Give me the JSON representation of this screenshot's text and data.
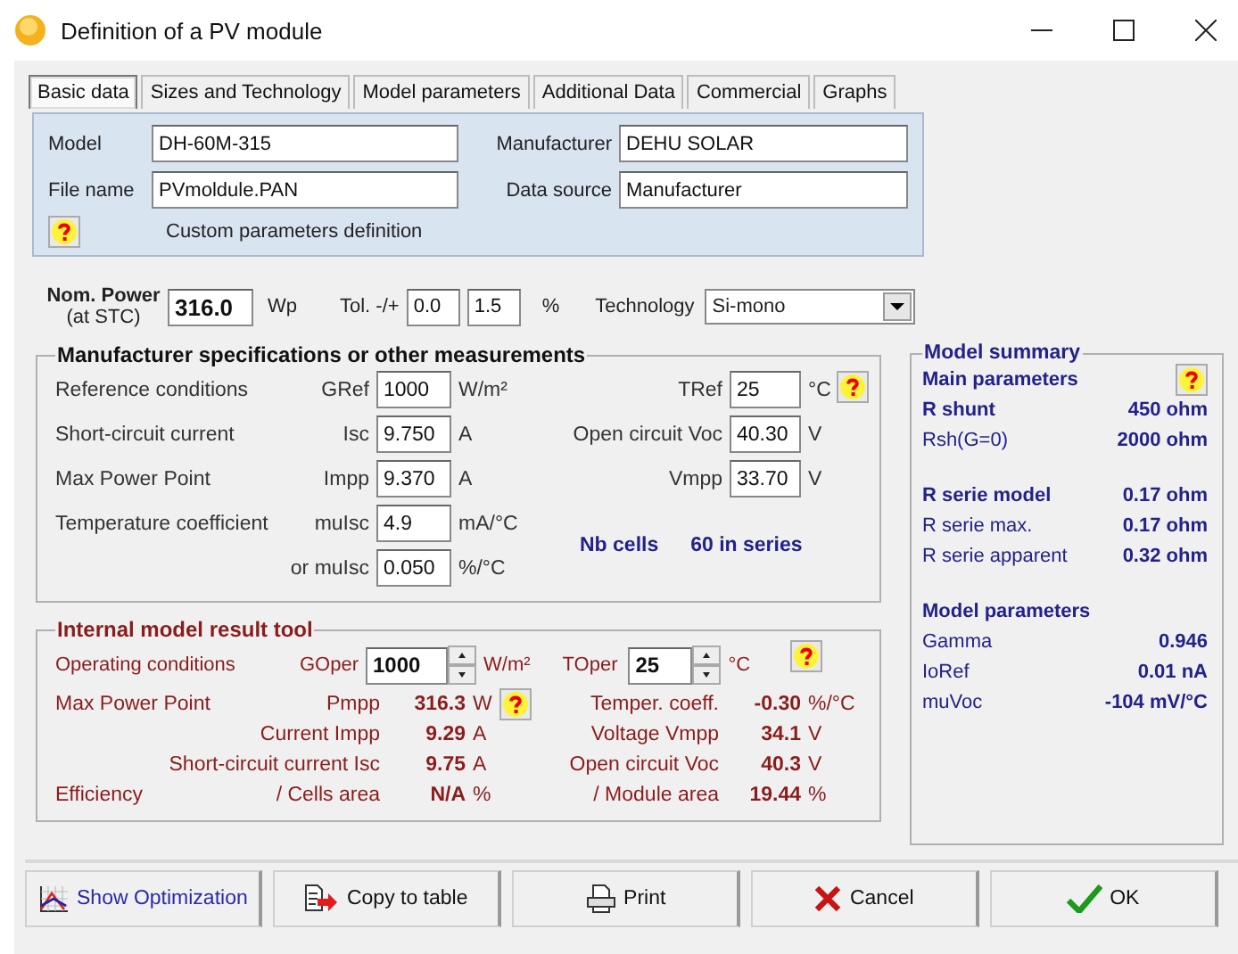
{
  "window": {
    "title": "Definition of a PV module"
  },
  "tabs": [
    {
      "label": "Basic data",
      "selected": true
    },
    {
      "label": "Sizes and Technology",
      "selected": false
    },
    {
      "label": "Model parameters",
      "selected": false
    },
    {
      "label": "Additional Data",
      "selected": false
    },
    {
      "label": "Commercial",
      "selected": false
    },
    {
      "label": "Graphs",
      "selected": false
    }
  ],
  "identity": {
    "fields": [
      {
        "label": "Model",
        "value": "DH-60M-315"
      },
      {
        "label": "Manufacturer",
        "value": "DEHU SOLAR"
      },
      {
        "label": "File name",
        "value": "PVmoldule.PAN"
      },
      {
        "label": "Data source",
        "value": "Manufacturer"
      }
    ],
    "note": "Custom parameters definition"
  },
  "nominal": {
    "label": "Nom. Power",
    "sublabel": "(at STC)",
    "value": "316.0",
    "unit": "Wp",
    "tol_label": "Tol. -/+",
    "tol_minus": "0.0",
    "tol_plus": "1.5",
    "tol_unit": "%",
    "tech_label": "Technology",
    "technology": "Si-mono"
  },
  "specs": {
    "title": "Manufacturer specifications or other measurements",
    "rows": [
      {
        "label": "Reference conditions",
        "symbol": "GRef",
        "value": "1000",
        "unit": "W/m²",
        "label2": "TRef",
        "value2": "25",
        "unit2": "°C"
      },
      {
        "label": "Short-circuit current",
        "symbol": "Isc",
        "value": "9.750",
        "unit": "A",
        "label2": "Open circuit Voc",
        "value2": "40.30",
        "unit2": "V"
      },
      {
        "label": "Max Power Point",
        "symbol": "Impp",
        "value": "9.370",
        "unit": "A",
        "label2": "Vmpp",
        "value2": "33.70",
        "unit2": "V"
      },
      {
        "label": "Temperature coefficient",
        "symbol": "muIsc",
        "value": "4.9",
        "unit": "mA/°C"
      },
      {
        "symbol": "or muIsc",
        "value": "0.050",
        "unit": "%/°C"
      }
    ],
    "cells_label": "Nb cells",
    "cells_value": "60 in series"
  },
  "result_tool": {
    "title": "Internal model result tool",
    "operating": {
      "label": "Operating conditions",
      "g_label": "GOper",
      "g_value": "1000",
      "g_unit": "W/m²",
      "t_label": "TOper",
      "t_value": "25",
      "t_unit": "°C"
    },
    "rows": [
      {
        "label": "Max Power Point",
        "symbol": "Pmpp",
        "value": "316.3",
        "unit": "W",
        "help": true,
        "label2": "Temper. coeff.",
        "value2": "-0.30",
        "unit2": "%/°C"
      },
      {
        "symbol": "Current Impp",
        "value": "9.29",
        "unit": "A",
        "help": false,
        "label2": "Voltage Vmpp",
        "value2": "34.1",
        "unit2": "V"
      },
      {
        "symbol": "Short-circuit current Isc",
        "value": "9.75",
        "unit": "A",
        "help": false,
        "label2": "Open circuit Voc",
        "value2": "40.3",
        "unit2": "V"
      },
      {
        "label": "Efficiency",
        "symbol": "/ Cells area",
        "value": "N/A",
        "unit": "%",
        "help": false,
        "label2": "/ Module area",
        "value2": "19.44",
        "unit2": "%"
      }
    ]
  },
  "summary": {
    "title": "Model summary",
    "items": [
      {
        "kind": "heading",
        "label": "Main parameters",
        "help": true
      },
      {
        "kind": "main",
        "label": "R shunt",
        "value": "450 ohm"
      },
      {
        "kind": "sub",
        "label": "Rsh(G=0)",
        "value": "2000 ohm"
      },
      {
        "kind": "main",
        "label": "R serie model",
        "value": "0.17 ohm"
      },
      {
        "kind": "sub",
        "label": "R serie max.",
        "value": "0.17 ohm"
      },
      {
        "kind": "sub",
        "label": "R serie apparent",
        "value": "0.32 ohm"
      },
      {
        "kind": "heading",
        "label": "Model parameters",
        "help": false
      },
      {
        "kind": "sub",
        "label": "Gamma",
        "value": "0.946"
      },
      {
        "kind": "sub",
        "label": "IoRef",
        "value": "0.01 nA"
      },
      {
        "kind": "sub",
        "label": "muVoc",
        "value": "-104 mV/°C"
      }
    ]
  },
  "buttons": [
    {
      "label": "Show Optimization",
      "kind": "optimize"
    },
    {
      "label": "Copy to table",
      "kind": "copy"
    },
    {
      "label": "Print",
      "kind": "print"
    },
    {
      "label": "Cancel",
      "kind": "cancel"
    },
    {
      "label": "OK",
      "kind": "ok"
    }
  ]
}
